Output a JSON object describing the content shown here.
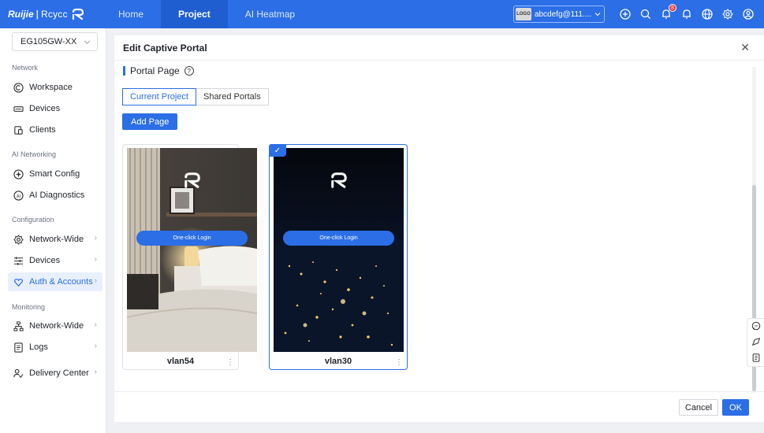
{
  "brand": {
    "ruijie": "Ruijie",
    "reyee": "Rcycc"
  },
  "topnav": [
    {
      "label": "Home"
    },
    {
      "label": "Project"
    },
    {
      "label": "AI Heatmap"
    }
  ],
  "account": {
    "logo_text": "LOGO",
    "name": "abcdefg@111...."
  },
  "notifications": {
    "count": "8"
  },
  "sidebar": {
    "device_selector": "EG105GW-XX",
    "sections": {
      "network": "Network",
      "ai_networking": "AI Networking",
      "configuration": "Configuration",
      "monitoring": "Monitoring"
    },
    "items": {
      "workspace": "Workspace",
      "devices": "Devices",
      "clients": "Clients",
      "smart_config": "Smart Config",
      "ai_diagnostics": "AI Diagnostics",
      "network_wide": "Network-Wide",
      "config_devices": "Devices",
      "auth_accounts": "Auth & Accounts",
      "mon_network_wide": "Network-Wide",
      "logs": "Logs",
      "delivery_center": "Delivery Center"
    }
  },
  "panel": {
    "title": "Edit Captive Portal",
    "section_title": "Portal Page",
    "tabs": [
      "Current Project",
      "Shared Portals"
    ],
    "add_button": "Add Page",
    "cards": [
      {
        "name": "vlan54",
        "login_label": "One-click Login",
        "selected": false
      },
      {
        "name": "vlan30",
        "login_label": "One-click Login",
        "selected": true
      }
    ],
    "cancel": "Cancel",
    "ok": "OK"
  },
  "colors": {
    "primary": "#2b6ee6",
    "badge": "#e7343f"
  }
}
